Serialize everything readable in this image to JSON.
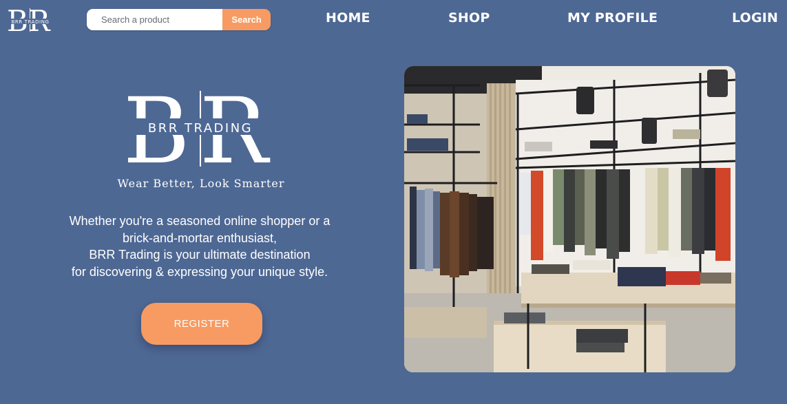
{
  "header": {
    "logo_text": "BR",
    "logo_subtext": "BRR TRADING",
    "search": {
      "placeholder": "Search a product",
      "button_label": "Search"
    },
    "nav": {
      "home": "HOME",
      "shop": "SHOP",
      "profile": "MY PROFILE",
      "login": "LOGIN"
    }
  },
  "hero": {
    "logo_letters": "BR",
    "brand_name": "BRR TRADING",
    "tagline": "Wear Better, Look Smarter",
    "description_lines": [
      "Whether you're a seasoned online shopper or a",
      "brick-and-mortar enthusiast,",
      "BRR Trading is your ultimate destination",
      "for discovering & expressing your unique style."
    ],
    "register_label": "REGISTER",
    "image": "clothing-store-interior"
  },
  "colors": {
    "background": "#4e6894",
    "accent": "#f79b62",
    "text": "#ffffff"
  }
}
